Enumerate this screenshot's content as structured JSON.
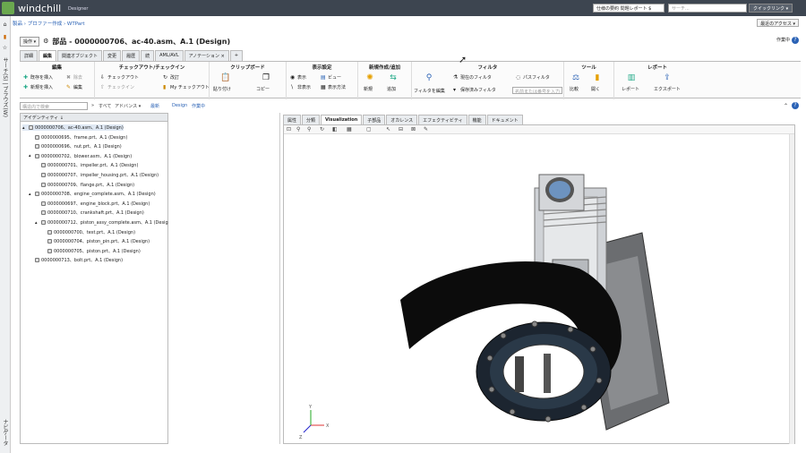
{
  "topbar": {
    "brand": "windchill",
    "brand_sub": "Designer",
    "select_1": "仕様の要約 問題レポート $",
    "search_placeholder": "サーチ...",
    "quick_link": "クイックリンク ▾",
    "recent_access": "最近のアクセス ▾"
  },
  "leftrail": {
    "search_label": "サーチ(S) | ブラウズ(W)",
    "navigator_label": "ナビゲータ"
  },
  "breadcrumb": "製品 › プロファー作成 › WTPart",
  "header": {
    "operations_button": "操作 ▾",
    "title": "部品 - 0000000706、ac-40.asm、A.1 (Design)",
    "status": "作業中"
  },
  "tabs": [
    "詳細",
    "編集",
    "関連オブジェクト",
    "変更",
    "履歴",
    "続",
    "AML/AVL",
    "アノテーション ×",
    "+"
  ],
  "active_tab_index": 1,
  "ribbon": {
    "edit": {
      "label": "編集",
      "insert_existing": "既存を挿入",
      "insert_new": "新規を挿入",
      "remove": "除去",
      "edit": "編集"
    },
    "checkout": {
      "label": "チェックアウト/チェックイン",
      "checkout": "チェックアウト",
      "checkin": "チェックイン",
      "revise": "改訂",
      "my_checkout": "My チェックアウト"
    },
    "clipboard": {
      "label": "クリップボード",
      "paste": "貼り付け",
      "copy": "コピー"
    },
    "display": {
      "label": "表示設定",
      "show": "表示",
      "hide": "非表示",
      "view": "ビュー",
      "display_method": "表示方法"
    },
    "new": {
      "label": "新規作成/追加",
      "new": "新規",
      "add": "追加"
    },
    "filter": {
      "label": "フィルタ",
      "edit_filter": "フィルタを編集",
      "current_filter": "現在のフィルタ",
      "saved_filter": "保存済みフィルタ",
      "path_filter": "パスフィルタ",
      "name_input_placeholder": "名前または番号を入力"
    },
    "tools": {
      "label": "ツール",
      "compare": "比較",
      "open": "開く"
    },
    "report": {
      "label": "レポート",
      "report": "レポート",
      "export": "エクスポート"
    }
  },
  "search_row": {
    "placeholder": "構造内で検索",
    "all": "すべて",
    "advanced": "アドバンス ▾",
    "latest": "最新",
    "design": "Design",
    "working": "作業中"
  },
  "tree": {
    "header": "アイデンティティ ↓",
    "nodes": [
      {
        "label": "0000000706、ac-40.asm、A.1 (Design)",
        "level": 0,
        "expanded": true
      },
      {
        "label": "0000000695、frame.prt、A.1 (Design)",
        "level": 1
      },
      {
        "label": "0000000696、nut.prt、A.1 (Design)",
        "level": 1
      },
      {
        "label": "0000000702、blower.asm、A.1 (Design)",
        "level": 1,
        "expanded": true
      },
      {
        "label": "0000000701、impeller.prt、A.1 (Design)",
        "level": 2
      },
      {
        "label": "0000000707、impeller_housing.prt、A.1 (Design)",
        "level": 2
      },
      {
        "label": "0000000709、flange.prt、A.1 (Design)",
        "level": 2
      },
      {
        "label": "0000000708、engine_complete.asm、A.1 (Design)",
        "level": 1,
        "expanded": true
      },
      {
        "label": "0000000697、engine_block.prt、A.1 (Design)",
        "level": 2
      },
      {
        "label": "0000000710、crankshaft.prt、A.1 (Design)",
        "level": 2
      },
      {
        "label": "0000000712、piston_assy_complete.asm、A.1 (Desig",
        "level": 2,
        "expanded": true
      },
      {
        "label": "0000000700、test.prt、A.1 (Design)",
        "level": 3
      },
      {
        "label": "0000000704、piston_pin.prt、A.1 (Design)",
        "level": 3
      },
      {
        "label": "0000000705、piston.prt、A.1 (Design)",
        "level": 3
      },
      {
        "label": "0000000713、bolt.prt、A.1 (Design)",
        "level": 1
      }
    ]
  },
  "viewer_tabs": [
    "属性",
    "分類",
    "Visualization",
    "子部品",
    "オカレンス",
    "エフェクティビティ",
    "機能",
    "ドキュメント"
  ],
  "active_viewer_tab_index": 2,
  "axis": {
    "x": "X",
    "y": "Y",
    "z": "Z"
  },
  "colors": {
    "topbar": "#3d4550",
    "accent": "#2a62b5",
    "logo": "#6aa84f"
  }
}
